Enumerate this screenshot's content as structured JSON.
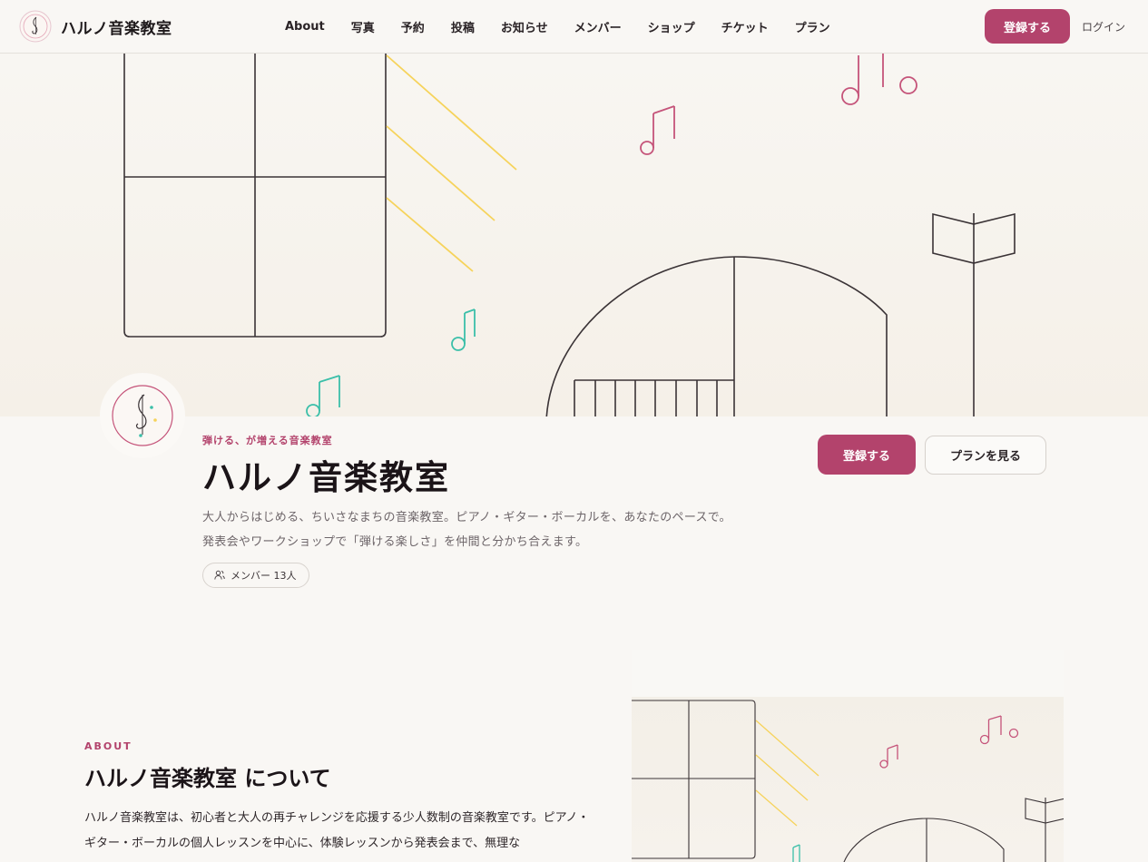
{
  "header": {
    "brand_name": "ハルノ音楽教室",
    "nav": [
      "About",
      "写真",
      "予約",
      "投稿",
      "お知らせ",
      "メンバー",
      "ショップ",
      "チケット",
      "プラン"
    ],
    "register_label": "登録する",
    "login_label": "ログイン"
  },
  "hero": {
    "tagline": "弾ける、が増える音楽教室",
    "title": "ハルノ音楽教室",
    "description_line1": "大人からはじめる、ちいさなまちの音楽教室。ピアノ・ギター・ボーカルを、あなたのペースで。",
    "description_line2": "発表会やワークショップで「弾ける楽しさ」を仲間と分かち合えます。",
    "member_count": "メンバー 13人",
    "register_label": "登録する",
    "plan_label": "プランを見る"
  },
  "about": {
    "eyebrow": "ABOUT",
    "title": "ハルノ音楽教室 について",
    "body": "ハルノ音楽教室は、初心者と大人の再チャレンジを応援する少人数制の音楽教室です。ピアノ・ギター・ボーカルの個人レッスンを中心に、体験レッスンから発表会まで、無理な"
  },
  "colors": {
    "accent": "#b3436c",
    "teal": "#3bbfa9",
    "yellow": "#f6d35b",
    "background": "#f9f7f4"
  }
}
